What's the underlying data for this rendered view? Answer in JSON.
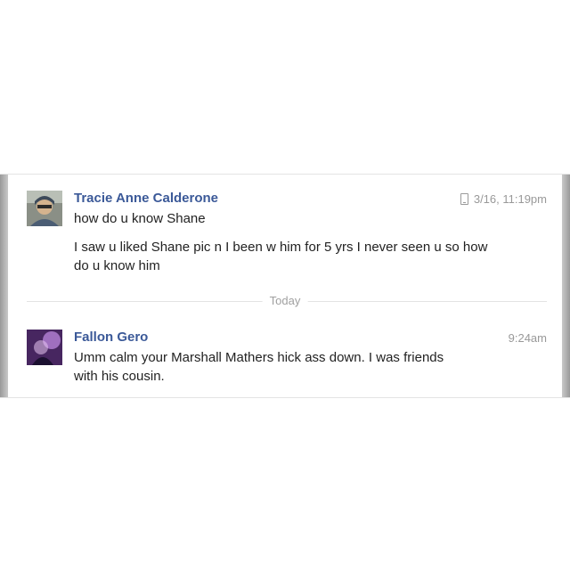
{
  "conversation": {
    "messages": [
      {
        "sender": "Tracie Anne Calderone",
        "time": "3/16, 11:19pm",
        "time_icon": "mobile-phone-icon",
        "lines": [
          "how do u know Shane",
          "I saw u liked Shane pic n I been w him for 5 yrs I never seen u so  how do u know him"
        ]
      },
      {
        "sender": "Fallon Gero",
        "time": "9:24am",
        "lines": [
          "Umm calm your Marshall Mathers hick ass down. I was friends with his cousin."
        ]
      }
    ],
    "divider_label": "Today"
  },
  "colors": {
    "sender_name": "#3b5998",
    "timestamp": "#999999",
    "message_text": "#222222"
  }
}
